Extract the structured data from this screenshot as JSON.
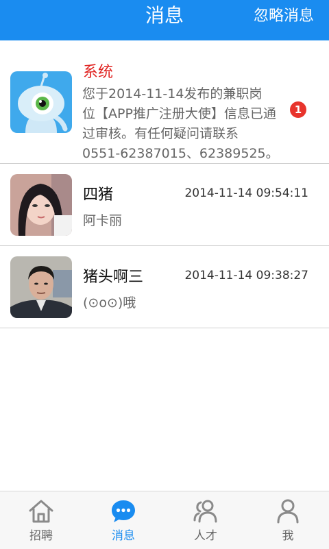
{
  "header": {
    "title": "消息",
    "ignore_label": "忽略消息"
  },
  "messages": [
    {
      "name": "系统",
      "body": "您于2014-11-14发布的兼职岗\n位【APP推广注册大使】信息已通\n过审核。有任何疑问请联系\n0551-62387015、62389525。",
      "badge": "1",
      "avatar_icon": "alien-mascot-icon"
    },
    {
      "name": "四猪",
      "time": "2014-11-14 09:54:11",
      "preview": "阿卡丽"
    },
    {
      "name": "猪头啊三",
      "time": "2014-11-14 09:38:27",
      "preview": "(⊙o⊙)哦"
    }
  ],
  "tabs": [
    {
      "label": "招聘",
      "icon": "home-icon",
      "active": false
    },
    {
      "label": "消息",
      "icon": "chat-bubble-icon",
      "active": true
    },
    {
      "label": "人才",
      "icon": "people-icon",
      "active": false
    },
    {
      "label": "我",
      "icon": "person-icon",
      "active": false
    }
  ],
  "colors": {
    "brand": "#1a8cf0",
    "system_name": "#e0211f",
    "badge": "#e8342c"
  }
}
